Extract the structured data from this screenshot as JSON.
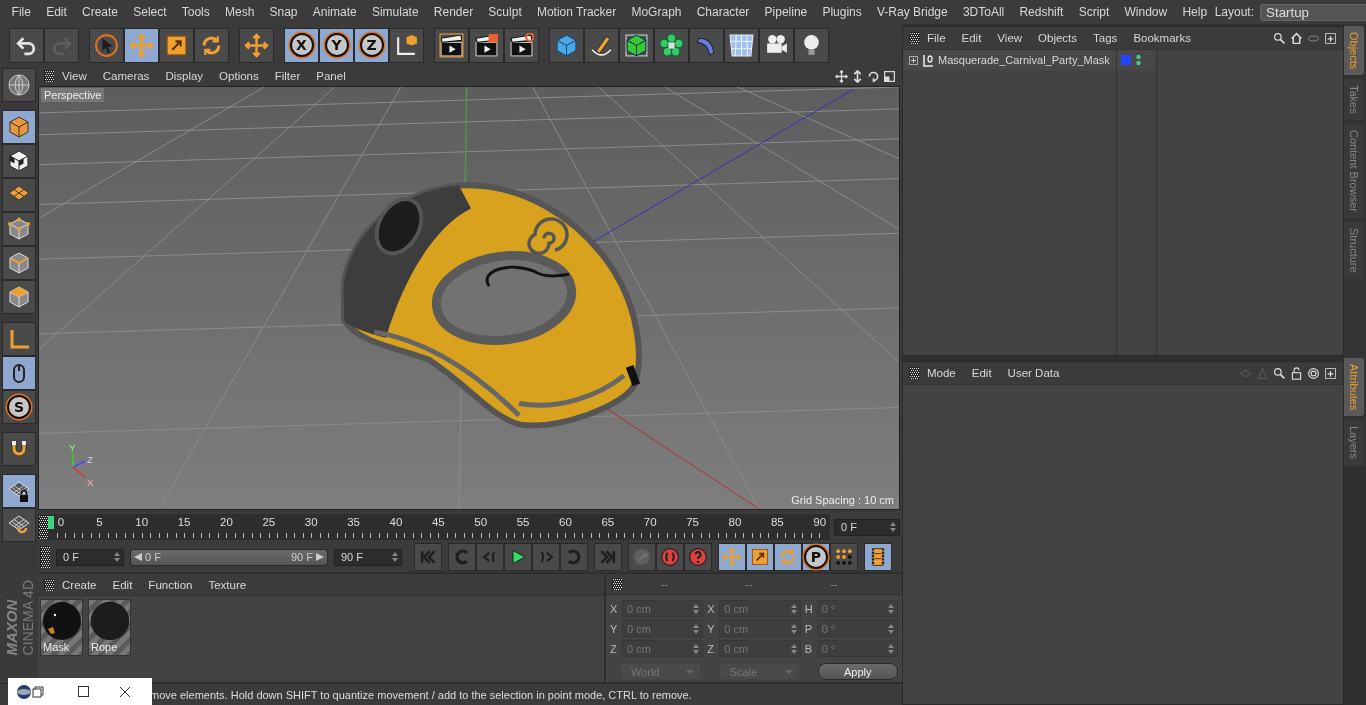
{
  "menu": [
    "File",
    "Edit",
    "Create",
    "Select",
    "Tools",
    "Mesh",
    "Snap",
    "Animate",
    "Simulate",
    "Render",
    "Sculpt",
    "Motion Tracker",
    "MoGraph",
    "Character",
    "Pipeline",
    "Plugins",
    "V-Ray Bridge",
    "3DToAll",
    "Redshift",
    "Script",
    "Window",
    "Help"
  ],
  "layout": {
    "label": "Layout:",
    "value": "Startup"
  },
  "toolbar": {
    "groups": [
      [
        {
          "kind": "undo",
          "selected": false,
          "disabled": false
        },
        {
          "kind": "redo",
          "selected": false,
          "disabled": true
        }
      ],
      [
        {
          "kind": "live_select",
          "selected": false,
          "disabled": false
        },
        {
          "kind": "move",
          "selected": true,
          "disabled": false
        },
        {
          "kind": "scale",
          "selected": false,
          "disabled": false
        },
        {
          "kind": "rotate",
          "selected": false,
          "disabled": false
        }
      ],
      [
        {
          "kind": "recent_move",
          "selected": false,
          "disabled": false
        }
      ],
      [
        {
          "kind": "axis_lock",
          "label": "X",
          "selected": true,
          "disabled": false
        },
        {
          "kind": "axis_lock",
          "label": "Y",
          "selected": true,
          "disabled": false
        },
        {
          "kind": "axis_lock",
          "label": "Z",
          "selected": true,
          "disabled": false
        },
        {
          "kind": "coordinate_system",
          "selected": false,
          "disabled": false
        }
      ],
      [
        {
          "kind": "render_view",
          "selected": false,
          "disabled": false
        },
        {
          "kind": "render_picture",
          "selected": false,
          "disabled": false
        },
        {
          "kind": "render_settings",
          "selected": false,
          "disabled": false
        }
      ],
      [
        {
          "kind": "cube",
          "selected": false,
          "disabled": false
        },
        {
          "kind": "pen",
          "selected": false,
          "disabled": false
        },
        {
          "kind": "subdivision",
          "selected": false,
          "disabled": false
        },
        {
          "kind": "cloner",
          "selected": false,
          "disabled": false
        },
        {
          "kind": "bend",
          "selected": false,
          "disabled": false
        },
        {
          "kind": "floor",
          "selected": false,
          "disabled": false
        },
        {
          "kind": "camera",
          "selected": false,
          "disabled": false
        },
        {
          "kind": "light",
          "selected": false,
          "disabled": false
        }
      ]
    ]
  },
  "tool_palette": {
    "groups": [
      [
        {
          "kind": "globe",
          "selected": false
        }
      ],
      [
        {
          "kind": "model",
          "selected": true
        },
        {
          "kind": "texture",
          "selected": false
        },
        {
          "kind": "workplane",
          "selected": false
        },
        {
          "kind": "points",
          "selected": false
        },
        {
          "kind": "edges",
          "selected": false
        },
        {
          "kind": "polygons",
          "selected": false
        }
      ],
      [
        {
          "kind": "axis",
          "selected": false
        },
        {
          "kind": "tweak",
          "selected": true
        },
        {
          "kind": "snap",
          "label": "S",
          "selected": false
        }
      ],
      [
        {
          "kind": "magnet",
          "selected": false
        }
      ],
      [
        {
          "kind": "lock_workplane",
          "selected": true
        },
        {
          "kind": "rotate_workplane",
          "selected": false
        }
      ]
    ]
  },
  "logo": {
    "brand": "MAXON",
    "product": "CINEMA 4D"
  },
  "viewport": {
    "menu": [
      "View",
      "Cameras",
      "Display",
      "Options",
      "Filter",
      "Panel"
    ],
    "camera": "Perspective",
    "grid_spacing": "Grid Spacing : 10 cm",
    "axis_labels": [
      "Y",
      "Z",
      "X"
    ]
  },
  "timeline": {
    "ticks": [
      "0",
      "5",
      "10",
      "15",
      "20",
      "25",
      "30",
      "35",
      "40",
      "45",
      "50",
      "55",
      "60",
      "65",
      "70",
      "75",
      "80",
      "85",
      "90"
    ],
    "current_frame": "0 F"
  },
  "transport": {
    "start": "0 F",
    "range": {
      "start": "0 F",
      "end": "90 F",
      "level": 1
    },
    "end": "90 F",
    "groups": [
      [
        {
          "kind": "skip_start",
          "selected": false,
          "disabled": false
        }
      ],
      [
        {
          "kind": "previous_key",
          "selected": false,
          "disabled": false
        },
        {
          "kind": "step_back",
          "selected": false,
          "disabled": false
        },
        {
          "kind": "play",
          "selected": false,
          "disabled": false
        },
        {
          "kind": "step_forward",
          "selected": false,
          "disabled": false
        },
        {
          "kind": "next_key",
          "selected": false,
          "disabled": false
        }
      ],
      [
        {
          "kind": "skip_end",
          "selected": false,
          "disabled": false
        }
      ],
      [
        {
          "kind": "keyframe",
          "selected": false,
          "disabled": true
        },
        {
          "kind": "record",
          "selected": false,
          "disabled": false
        },
        {
          "kind": "autokey",
          "selected": false,
          "disabled": false
        }
      ],
      [
        {
          "kind": "move",
          "selected": true,
          "disabled": false
        },
        {
          "kind": "scale",
          "selected": true,
          "disabled": false
        },
        {
          "kind": "rotate",
          "selected": true,
          "disabled": false
        },
        {
          "kind": "parameter_key",
          "label": "P",
          "selected": true,
          "disabled": false
        },
        {
          "kind": "point_level",
          "selected": false,
          "disabled": false
        }
      ],
      [
        {
          "kind": "timeline",
          "selected": true,
          "disabled": false
        }
      ]
    ]
  },
  "materials": {
    "menu": [
      "Create",
      "Edit",
      "Function",
      "Texture"
    ],
    "items": [
      {
        "name": "Mask",
        "kind": "highlight"
      },
      {
        "name": "Rope",
        "kind": "plain"
      }
    ]
  },
  "coordinates": {
    "headers": [
      "--",
      "--",
      "--"
    ],
    "columns": [
      [
        {
          "label": "X",
          "value": "0 cm"
        },
        {
          "label": "Y",
          "value": "0 cm"
        },
        {
          "label": "Z",
          "value": "0 cm"
        }
      ],
      [
        {
          "label": "X",
          "value": "0 cm"
        },
        {
          "label": "Y",
          "value": "0 cm"
        },
        {
          "label": "Z",
          "value": "0 cm"
        }
      ],
      [
        {
          "label": "H",
          "value": "0 °"
        },
        {
          "label": "P",
          "value": "0 °"
        },
        {
          "label": "B",
          "value": "0 °"
        }
      ]
    ],
    "dropdowns": [
      "World",
      "Scale"
    ],
    "apply": "Apply",
    "disabled": true
  },
  "status_bar": {
    "text": "move elements. Hold down SHIFT to quantize movement / add to the selection in point mode, CTRL to remove."
  },
  "objects": {
    "menu": [
      "File",
      "Edit",
      "View",
      "Objects",
      "Tags",
      "Bookmarks"
    ],
    "items": [
      {
        "name": "Masquerade_Carnival_Party_Mask",
        "color": "#2244ff",
        "expanded": false
      }
    ]
  },
  "attributes": {
    "menu": [
      "Mode",
      "Edit",
      "User Data"
    ]
  },
  "side_tabs_top": [
    {
      "label": "Objects",
      "selected": true
    },
    {
      "label": "Takes",
      "selected": false
    },
    {
      "label": "Content Browser",
      "selected": false
    },
    {
      "label": "Structure",
      "selected": false
    }
  ],
  "side_tabs_bottom": [
    {
      "label": "Attributes",
      "selected": true
    },
    {
      "label": "Layers",
      "selected": false
    }
  ]
}
